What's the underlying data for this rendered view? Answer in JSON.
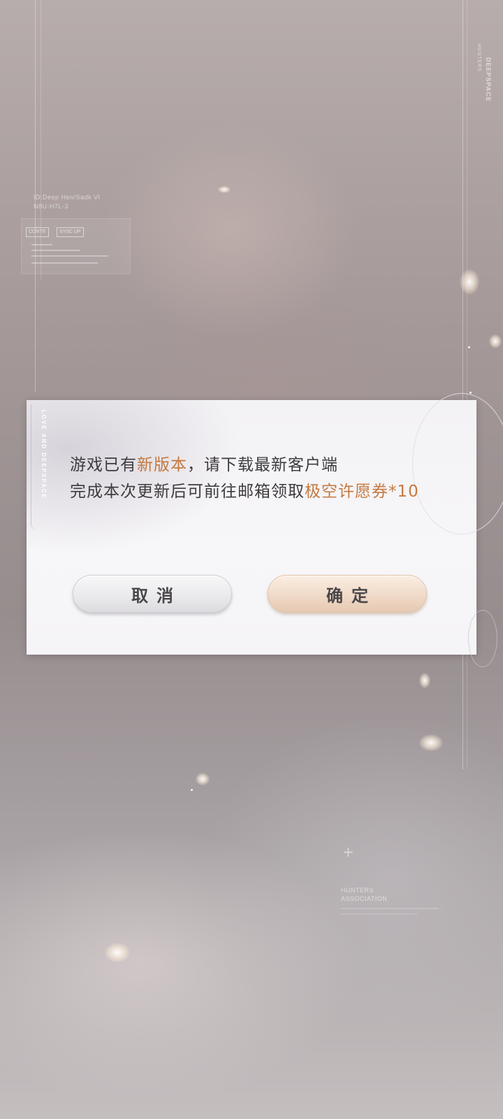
{
  "background": {
    "brand_vertical": "DEEPSPACE",
    "brand_sub_vertical": "HUNTERS",
    "info_line_1": "ID:Deep Hen/Sadk VI",
    "info_line_2": "N8U-H7L-3",
    "tag_1": "CONTE",
    "tag_2": "SYSC UP",
    "association_line_1": "HUNTERS",
    "association_line_2": "ASSOCIATION"
  },
  "dialog": {
    "side_text": "LOVE AND DEEPSPACE",
    "line1_before": "游戏已有",
    "line1_highlight": "新版本",
    "line1_after": "，请下载最新客户端",
    "line2_before": "完成本次更新后可前往邮箱领取",
    "line2_highlight": "极空许愿券",
    "line2_after": "*10",
    "highlight_color": "#c5793f",
    "cancel_label": "取消",
    "confirm_label": "确定"
  }
}
